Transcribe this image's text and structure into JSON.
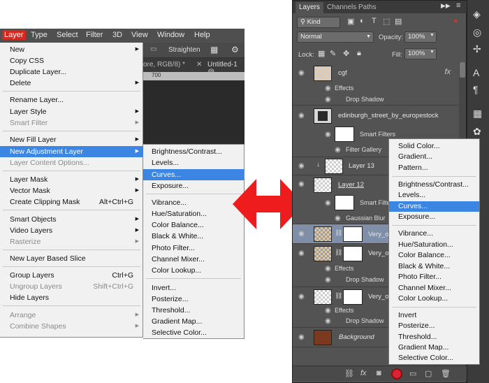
{
  "menubar": {
    "items": [
      "Layer",
      "Type",
      "Select",
      "Filter",
      "3D",
      "View",
      "Window",
      "Help"
    ]
  },
  "ps_toolbar": {
    "straighten": "Straighten",
    "tab1": "ore, RGB/8) *",
    "tab2": "Untitled-1 @",
    "ruler_mark": "700"
  },
  "layer_menu": {
    "items": [
      {
        "label": "New",
        "arrow": true
      },
      {
        "label": "Copy CSS"
      },
      {
        "label": "Duplicate Layer..."
      },
      {
        "label": "Delete",
        "arrow": true
      },
      {
        "label": "Rename Layer..."
      },
      {
        "label": "Layer Style",
        "arrow": true
      },
      {
        "label": "Smart Filter",
        "arrow": true,
        "disabled": true
      },
      {
        "label": "New Fill Layer",
        "arrow": true
      },
      {
        "label": "New Adjustment Layer",
        "arrow": true,
        "highlighted": true
      },
      {
        "label": "Layer Content Options...",
        "disabled": true
      },
      {
        "label": "Layer Mask",
        "arrow": true
      },
      {
        "label": "Vector Mask",
        "arrow": true
      },
      {
        "label": "Create Clipping Mask",
        "shortcut": "Alt+Ctrl+G"
      },
      {
        "label": "Smart Objects",
        "arrow": true
      },
      {
        "label": "Video Layers",
        "arrow": true
      },
      {
        "label": "Rasterize",
        "arrow": true,
        "disabled": true
      },
      {
        "label": "New Layer Based Slice"
      },
      {
        "label": "Group Layers",
        "shortcut": "Ctrl+G"
      },
      {
        "label": "Ungroup Layers",
        "shortcut": "Shift+Ctrl+G",
        "disabled": true
      },
      {
        "label": "Hide Layers"
      },
      {
        "label": "Arrange",
        "arrow": true,
        "disabled": true
      },
      {
        "label": "Combine Shapes",
        "arrow": true,
        "disabled": true
      }
    ]
  },
  "adjustment_menu": {
    "items": [
      {
        "label": "Brightness/Contrast..."
      },
      {
        "label": "Levels..."
      },
      {
        "label": "Curves...",
        "highlighted": true
      },
      {
        "label": "Exposure..."
      },
      {
        "label": "Vibrance..."
      },
      {
        "label": "Hue/Saturation..."
      },
      {
        "label": "Color Balance..."
      },
      {
        "label": "Black & White..."
      },
      {
        "label": "Photo Filter..."
      },
      {
        "label": "Channel Mixer..."
      },
      {
        "label": "Color Lookup..."
      },
      {
        "label": "Invert..."
      },
      {
        "label": "Posterize..."
      },
      {
        "label": "Threshold..."
      },
      {
        "label": "Gradient Map..."
      },
      {
        "label": "Selective Color..."
      }
    ]
  },
  "layers_panel": {
    "tabs": [
      "Layers",
      "Channels",
      "Paths"
    ],
    "kind": "Kind",
    "blend_mode": "Normal",
    "opacity_label": "Opacity:",
    "opacity_value": "100%",
    "lock_label": "Lock:",
    "fill_label": "Fill:",
    "fill_value": "100%",
    "fx_mark": "fx",
    "layers": {
      "cgf": "cgf",
      "effects": "Effects",
      "drop_shadow": "Drop Shadow",
      "edinburgh": "edinburgh_street_by_europestock",
      "smart_filters": "Smart Filters",
      "filter_gallery": "Filter Gallery",
      "layer13": "Layer 13",
      "layer12": "Layer 12",
      "smart_filter_short": "Smart Filter",
      "gaussian_blur": "Gaussian Blur",
      "very1": "Very_ol",
      "very2": "Very_ol",
      "very3": "Very_ol",
      "background": "Background"
    }
  },
  "right_adj_menu": {
    "items": [
      {
        "label": "Solid Color..."
      },
      {
        "label": "Gradient..."
      },
      {
        "label": "Pattern..."
      },
      {
        "label": "Brightness/Contrast..."
      },
      {
        "label": "Levels..."
      },
      {
        "label": "Curves...",
        "highlighted": true
      },
      {
        "label": "Exposure..."
      },
      {
        "label": "Vibrance..."
      },
      {
        "label": "Hue/Saturation..."
      },
      {
        "label": "Color Balance..."
      },
      {
        "label": "Black & White..."
      },
      {
        "label": "Photo Filter..."
      },
      {
        "label": "Channel Mixer..."
      },
      {
        "label": "Color Lookup..."
      },
      {
        "label": "Invert"
      },
      {
        "label": "Posterize..."
      },
      {
        "label": "Threshold..."
      },
      {
        "label": "Gradient Map..."
      },
      {
        "label": "Selective Color..."
      }
    ]
  },
  "colors": {
    "highlight": "#3c86e3",
    "accent_red": "#d7281d",
    "panel_bg": "#535353",
    "menu_bg": "#f1f1f1"
  }
}
